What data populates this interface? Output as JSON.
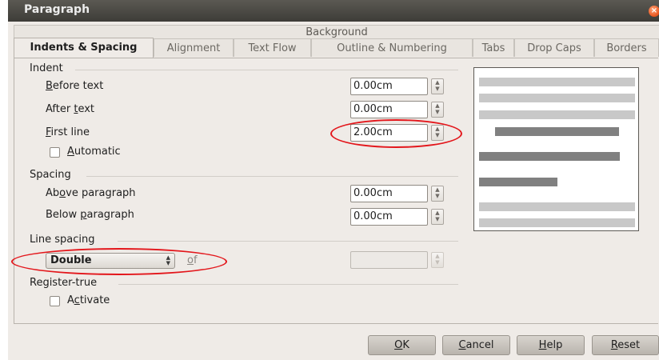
{
  "window": {
    "title": "Paragraph"
  },
  "tabs": {
    "background_label": "Background",
    "items": [
      {
        "label": "Indents & Spacing",
        "active": true
      },
      {
        "label": "Alignment"
      },
      {
        "label": "Text Flow"
      },
      {
        "label": "Outline & Numbering"
      },
      {
        "label": "Tabs"
      },
      {
        "label": "Drop Caps"
      },
      {
        "label": "Borders"
      }
    ]
  },
  "indent": {
    "section_label": "Indent",
    "before_text": {
      "label_pre": "",
      "label_ul": "B",
      "label_post": "efore text",
      "value": "0.00cm"
    },
    "after_text": {
      "label_pre": "After ",
      "label_ul": "t",
      "label_post": "ext",
      "value": "0.00cm"
    },
    "first_line": {
      "label_pre": "",
      "label_ul": "F",
      "label_post": "irst line",
      "value": "2.00cm"
    },
    "automatic": {
      "label_pre": "",
      "label_ul": "A",
      "label_post": "utomatic",
      "checked": false
    }
  },
  "spacing": {
    "section_label": "Spacing",
    "above": {
      "label_pre": "Ab",
      "label_ul": "o",
      "label_post": "ve paragraph",
      "value": "0.00cm"
    },
    "below": {
      "label_pre": "Below ",
      "label_ul": "p",
      "label_post": "aragraph",
      "value": "0.00cm"
    }
  },
  "line_spacing": {
    "section_label": "Line spacing",
    "selected": "Double",
    "of_label_ul": "o",
    "of_label_post": "f",
    "of_value": ""
  },
  "register_true": {
    "section_label": "Register-true",
    "activate": {
      "label_pre": "A",
      "label_ul": "c",
      "label_post": "tivate",
      "checked": false
    }
  },
  "buttons": {
    "ok": {
      "label_ul": "O",
      "label_post": "K"
    },
    "cancel": {
      "label_ul": "C",
      "label_post": "ancel"
    },
    "help": {
      "label_ul": "H",
      "label_post": "elp"
    },
    "reset": {
      "label_ul": "R",
      "label_post": "eset"
    }
  },
  "colors": {
    "highlight_ellipse": "#e3161b",
    "titlebar": "#3d3c38",
    "preview_dark": "#808080",
    "preview_light": "#c8c8c8"
  },
  "icons": {
    "close": "close-icon",
    "spin": "spin-arrows-icon",
    "dropdown": "dropdown-arrows-icon"
  }
}
